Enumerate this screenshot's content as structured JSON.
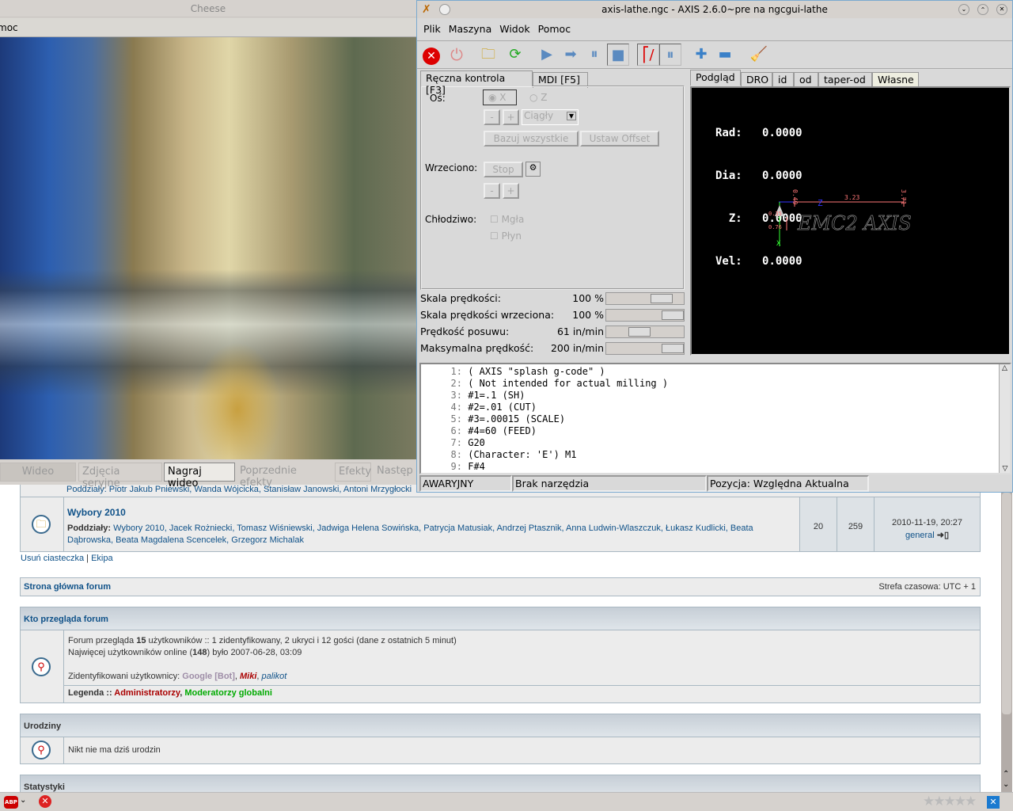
{
  "cheese": {
    "title": "Cheese",
    "menu_fragment": "moc",
    "buttons": [
      "Wideo",
      "Zdjęcia seryjne",
      "Nagraj wideo",
      "Poprzednie efekty",
      "Efekty",
      "Następ"
    ]
  },
  "axis": {
    "title": "axis-lathe.ngc - AXIS 2.6.0~pre na ngcgui-lathe",
    "menu": [
      "Plik",
      "Maszyna",
      "Widok",
      "Pomoc"
    ],
    "toolbar_icons": [
      "estop-icon",
      "power-icon",
      "open-folder-icon",
      "reload-icon",
      "run-icon",
      "step-icon",
      "pause-icon",
      "stop-icon",
      "block-delete-icon",
      "optional-stop-icon",
      "zoom-in-icon",
      "zoom-out-icon",
      "clear-plot-icon"
    ],
    "left_tabs": [
      "Ręczna kontrola [F3]",
      "MDI [F5]"
    ],
    "right_tabs": [
      "Podgląd",
      "DRO",
      "id",
      "od",
      "taper-od",
      "Własne"
    ],
    "manual": {
      "axis_label": "Oś:",
      "axis_x": "X",
      "axis_z": "Z",
      "minus": "-",
      "plus": "+",
      "jog_mode": "Ciągły",
      "home_all": "Bazuj wszystkie",
      "touch_off": "Ustaw Offset",
      "spindle_label": "Wrzeciono:",
      "spindle_stop": "Stop",
      "coolant_label": "Chłodziwo:",
      "mist": "Mgła",
      "flood": "Płyn"
    },
    "sliders": [
      {
        "label": "Skala prędkości:",
        "value": "100 %",
        "fraction": 0.8
      },
      {
        "label": "Skala prędkości wrzeciona:",
        "value": "100 %",
        "fraction": 1.0
      },
      {
        "label": "Prędkość posuwu:",
        "value": "61 in/min",
        "fraction": 0.4
      },
      {
        "label": "Maksymalna prędkość:",
        "value": "200 in/min",
        "fraction": 1.0
      }
    ],
    "dro": [
      {
        "label": "Rad:",
        "value": "0.0000"
      },
      {
        "label": "Dia:",
        "value": "0.0000"
      },
      {
        "label": "  Z:",
        "value": "0.0000"
      },
      {
        "label": "Vel:",
        "value": "0.0000"
      }
    ],
    "preview": {
      "dim_top_left": "0.49",
      "dim_top_right": "3.71",
      "dim_mid": "3.23",
      "dim_left1": "0.35",
      "dim_left2": "0.76",
      "z_axis": "Z",
      "x_axis": "X",
      "logo": "EMC2 AXIS"
    },
    "gcode": [
      {
        "n": "1:",
        "t": "( AXIS \"splash g-code\" )"
      },
      {
        "n": "2:",
        "t": "( Not intended for actual milling )"
      },
      {
        "n": "3:",
        "t": "#1=.1 (SH)"
      },
      {
        "n": "4:",
        "t": "#2=.01 (CUT)"
      },
      {
        "n": "5:",
        "t": "#3=.00015 (SCALE)"
      },
      {
        "n": "6:",
        "t": "#4=60 (FEED)"
      },
      {
        "n": "7:",
        "t": "G20"
      },
      {
        "n": "8:",
        "t": "(Character: 'E') M1"
      },
      {
        "n": "9:",
        "t": "F#4"
      }
    ],
    "status": [
      "AWARYJNY",
      "Brak narzędzia",
      "Pozycja: Względna Aktualna"
    ]
  },
  "forum": {
    "row_partial": "Poddziały: Piotr Jakub Pniewski, Wanda Wójcicka, Stanisław Janowski, Antoni Mrzygłocki",
    "row": {
      "title": "Wybory 2010",
      "sub_label": "Poddziały:",
      "subs": "Wybory 2010, Jacek Rożniecki, Tomasz Wiśniewski, Jadwiga Helena Sowińska, Patrycja Matusiak, Andrzej Ptasznik, Anna Ludwin-Wlaszczuk, Łukasz Kudlicki, Beata Dąbrowska, Beata Magdalena Scencelek, Grzegorz Michalak",
      "topics": "20",
      "posts": "259",
      "last_date": "2010-11-19, 20:27",
      "last_user": "general"
    },
    "links": [
      "Usuń ciasteczka",
      "Ekipa"
    ],
    "nav_home": "Strona główna forum",
    "timezone": "Strefa czasowa: UTC + 1",
    "who_title": "Kto przegląda forum",
    "who_line1_a": "Forum przegląda ",
    "who_line1_b": "15",
    "who_line1_c": " użytkowników :: 1 zidentyfikowany, 2 ukryci i 12 gości (dane z ostatnich 5 minut)",
    "who_line2_a": "Najwięcej użytkowników online (",
    "who_line2_b": "148",
    "who_line2_c": ") było 2007-06-28, 03:09",
    "who_users_label": "Zidentyfikowani użytkownicy: ",
    "who_users": [
      "Google [Bot]",
      "Miki",
      "palikot"
    ],
    "legend_label": "Legenda :: ",
    "legend_admin": "Administratorzy",
    "legend_mod": "Moderatorzy globalni",
    "bday_title": "Urodziny",
    "bday_text": "Nikt nie ma dziś urodzin",
    "stats_title": "Statystyki"
  },
  "statusbar": {
    "abp": "ABP",
    "rating_stars": 0
  }
}
